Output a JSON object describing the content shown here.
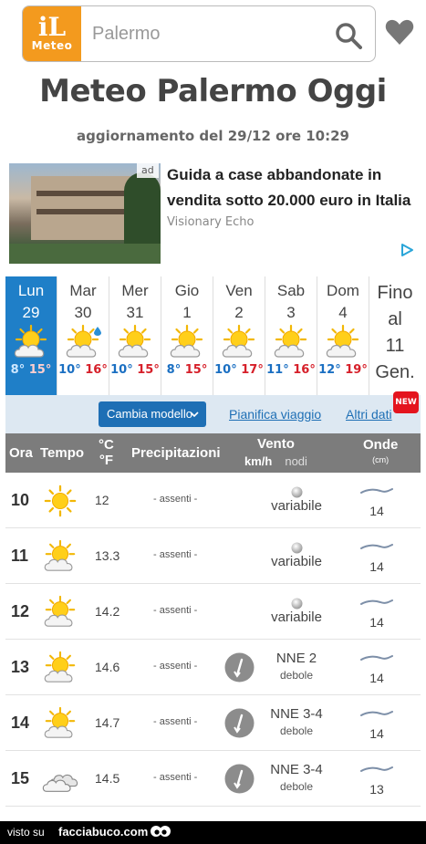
{
  "header": {
    "logo_top": "iL",
    "logo_text": "Meteo",
    "search_value": "Palermo"
  },
  "title": "Meteo Palermo Oggi",
  "updated": "aggiornamento del 29/12 ore 10:29",
  "ad": {
    "badge": "ad",
    "title": "Guida a case abbandonate in vendita sotto 20.000 euro in Italia",
    "source": "Visionary Echo"
  },
  "days": [
    {
      "name": "Lun",
      "num": "29",
      "min": "8°",
      "max": "15°",
      "icon": "sun-cloud-icon"
    },
    {
      "name": "Mar",
      "num": "30",
      "min": "10°",
      "max": "16°",
      "icon": "sun-cloud-icon"
    },
    {
      "name": "Mer",
      "num": "31",
      "min": "10°",
      "max": "15°",
      "icon": "sun-cloud-icon"
    },
    {
      "name": "Gio",
      "num": "1",
      "min": "8°",
      "max": "15°",
      "icon": "sun-cloud-icon"
    },
    {
      "name": "Ven",
      "num": "2",
      "min": "10°",
      "max": "17°",
      "icon": "sun-cloud-icon"
    },
    {
      "name": "Sab",
      "num": "3",
      "min": "11°",
      "max": "16°",
      "icon": "sun-cloud-icon"
    },
    {
      "name": "Dom",
      "num": "4",
      "min": "12°",
      "max": "19°",
      "icon": "sun-cloud-icon"
    }
  ],
  "fino": {
    "l1": "Fino",
    "l2": "al",
    "l3": "11",
    "l4": "Gen."
  },
  "model_bar": {
    "model_button": "Cambia modello",
    "link_trip": "Pianifica viaggio",
    "link_more": "Altri dati",
    "new_badge": "NEW"
  },
  "table_header": {
    "ora": "Ora",
    "tempo": "Tempo",
    "celsius": "°C",
    "fahrenheit": "°F",
    "precipitazioni": "Precipitazioni",
    "vento": "Vento",
    "kmh": "km/h",
    "nodi": "nodi",
    "onde": "Onde",
    "cm": "(cm)"
  },
  "rows": [
    {
      "hour": "10",
      "icon": "sun-icon",
      "temp": "12",
      "prec": "- assenti -",
      "wind": "variabile",
      "wind_sub": "",
      "wave": "14"
    },
    {
      "hour": "11",
      "icon": "sun-cloud-icon",
      "temp": "13.3",
      "prec": "- assenti -",
      "wind": "variabile",
      "wind_sub": "",
      "wave": "14"
    },
    {
      "hour": "12",
      "icon": "sun-cloud-icon",
      "temp": "14.2",
      "prec": "- assenti -",
      "wind": "variabile",
      "wind_sub": "",
      "wave": "14"
    },
    {
      "hour": "13",
      "icon": "sun-cloud-icon",
      "temp": "14.6",
      "prec": "- assenti -",
      "wind": "NNE 2",
      "wind_sub": "debole",
      "wave": "14"
    },
    {
      "hour": "14",
      "icon": "sun-cloud-icon",
      "temp": "14.7",
      "prec": "- assenti -",
      "wind": "NNE 3-4",
      "wind_sub": "debole",
      "wave": "14"
    },
    {
      "hour": "15",
      "icon": "cloud-icon",
      "temp": "14.5",
      "prec": "- assenti -",
      "wind": "NNE 3-4",
      "wind_sub": "debole",
      "wave": "13"
    }
  ],
  "footer": {
    "visto": "visto su",
    "site": "facciabuco.com"
  },
  "colors": {
    "brand_orange": "#f39a1e",
    "active_day": "#1f7fc8",
    "min_temp": "#1a6fc2",
    "max_temp": "#d6202a",
    "link": "#1e6fb5",
    "header_gray": "#7c7c7c"
  }
}
